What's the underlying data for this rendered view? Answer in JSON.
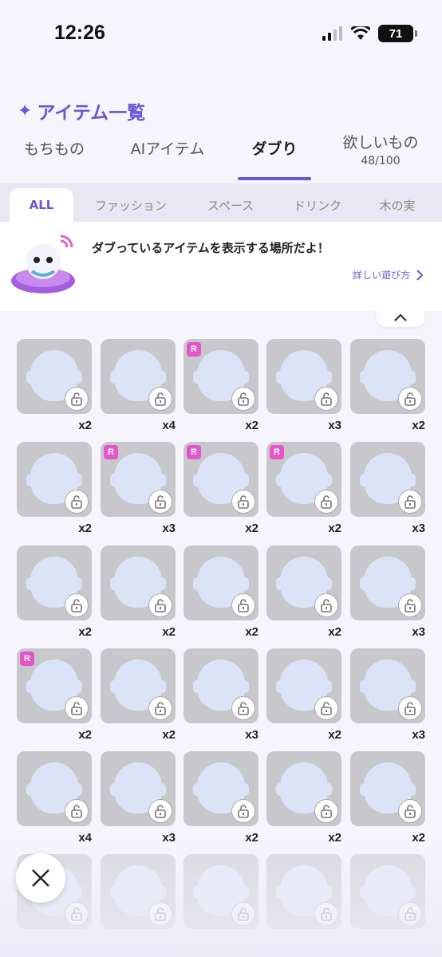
{
  "status_bar": {
    "time": "12:26",
    "battery": "71"
  },
  "header": {
    "title": "アイテム一覧"
  },
  "tabs": [
    {
      "label": "もちもの",
      "sub": ""
    },
    {
      "label": "AIアイテム",
      "sub": ""
    },
    {
      "label": "ダブり",
      "sub": "",
      "active": true
    },
    {
      "label": "欲しいもの",
      "sub": "48/100"
    }
  ],
  "categories": [
    "ALL",
    "ファッション",
    "スペース",
    "ドリンク",
    "木の実"
  ],
  "banner": {
    "message": "ダブっているアイテムを表示する場所だよ！",
    "link": "詳しい遊び方"
  },
  "items": [
    {
      "count": "x2",
      "rare": false,
      "icon": "face-blush"
    },
    {
      "count": "x4",
      "rare": false,
      "icon": "pink-headband"
    },
    {
      "count": "x2",
      "rare": true,
      "icon": "black-pink-hair"
    },
    {
      "count": "x3",
      "rare": false,
      "icon": "pattern-bg"
    },
    {
      "count": "x2",
      "rare": false,
      "icon": "stickers"
    },
    {
      "count": "x2",
      "rare": false,
      "icon": "pink-butterflies"
    },
    {
      "count": "x3",
      "rare": true,
      "icon": "sparkle-effect"
    },
    {
      "count": "x2",
      "rare": true,
      "icon": "black-shoes"
    },
    {
      "count": "x2",
      "rare": true,
      "icon": "blue-cap"
    },
    {
      "count": "x3",
      "rare": false,
      "icon": "halo-rings"
    },
    {
      "count": "x2",
      "rare": false,
      "icon": "grey-skirt"
    },
    {
      "count": "x2",
      "rare": false,
      "icon": "black-jacket"
    },
    {
      "count": "x2",
      "rare": false,
      "icon": "pink-hoodie"
    },
    {
      "count": "x2",
      "rare": false,
      "icon": "suitcase"
    },
    {
      "count": "x3",
      "rare": false,
      "icon": "black-skirt"
    },
    {
      "count": "x2",
      "rare": true,
      "icon": "yellow-jacket"
    },
    {
      "count": "x2",
      "rare": false,
      "icon": "plain-head"
    },
    {
      "count": "x3",
      "rare": false,
      "icon": "black-shorts"
    },
    {
      "count": "x2",
      "rare": false,
      "icon": "bear-hat"
    },
    {
      "count": "x3",
      "rare": false,
      "icon": "purple-boots"
    },
    {
      "count": "x4",
      "rare": false,
      "icon": "hair-clip"
    },
    {
      "count": "x3",
      "rare": false,
      "icon": "kunai"
    },
    {
      "count": "x2",
      "rare": false,
      "icon": "slippers"
    },
    {
      "count": "x2",
      "rare": false,
      "icon": "flower-tattoo"
    },
    {
      "count": "x2",
      "rare": false,
      "icon": "blush-face"
    },
    {
      "count": "",
      "rare": false,
      "icon": "socks"
    },
    {
      "count": "",
      "rare": false,
      "icon": "small-sparkles"
    },
    {
      "count": "",
      "rare": false,
      "icon": "light-beams"
    },
    {
      "count": "",
      "rare": false,
      "icon": "dots-pattern"
    },
    {
      "count": "",
      "rare": false,
      "icon": "purple-sandals"
    }
  ],
  "colors": {
    "accent": "#6a55d8",
    "rare_badge": "#e655c8",
    "tile_bg": "#c8c8cc"
  }
}
